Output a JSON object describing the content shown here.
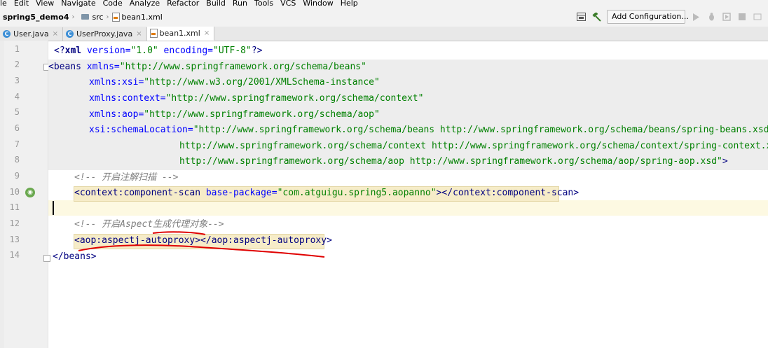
{
  "menu": [
    "le",
    "Edit",
    "View",
    "Navigate",
    "Code",
    "Analyze",
    "Refactor",
    "Build",
    "Run",
    "Tools",
    "VCS",
    "Window",
    "Help"
  ],
  "breadcrumb": {
    "project": "spring5_demo4",
    "folder": "src",
    "file": "bean1.xml"
  },
  "toolbar": {
    "config_label": "Add Configuration..."
  },
  "tabs": [
    {
      "label": "User.java",
      "icon": "class-icon",
      "active": false
    },
    {
      "label": "UserProxy.java",
      "icon": "class-icon",
      "active": false
    },
    {
      "label": "bean1.xml",
      "icon": "xml-icon",
      "active": true
    }
  ],
  "editor": {
    "line_numbers": [
      "1",
      "2",
      "3",
      "4",
      "5",
      "6",
      "7",
      "8",
      "9",
      "10",
      "11",
      "12",
      "13",
      "14"
    ],
    "lines": {
      "l1": {
        "open": "<?",
        "tag": "xml",
        "a1": " version=",
        "v1": "\"1.0\"",
        "a2": " encoding=",
        "v2": "\"UTF-8\"",
        "close": "?>"
      },
      "l2": {
        "open": "<",
        "tag": "beans",
        "attr": " xmlns=",
        "val": "\"http://www.springframework.org/schema/beans\""
      },
      "l3": {
        "attr": "xmlns:xsi=",
        "val": "\"http://www.w3.org/2001/XMLSchema-instance\""
      },
      "l4": {
        "attr": "xmlns:context=",
        "val": "\"http://www.springframework.org/schema/context\""
      },
      "l5": {
        "attr": "xmlns:aop=",
        "val": "\"http://www.springframework.org/schema/aop\""
      },
      "l6": {
        "attr": "xsi:schemaLocation=",
        "val": "\"http://www.springframework.org/schema/beans http://www.springframework.org/schema/beans/spring-beans.xsd"
      },
      "l7": {
        "val": "http://www.springframework.org/schema/context http://www.springframework.org/schema/context/spring-context.xsd"
      },
      "l8": {
        "val": "http://www.springframework.org/schema/aop http://www.springframework.org/schema/aop/spring-aop.xsd\"",
        "close": ">"
      },
      "l9": {
        "comment": "<!-- 开启注解扫描 -->"
      },
      "l10": {
        "open": "<",
        "tag": "context:component-scan",
        "attr": " base-package=",
        "val": "\"com.atguigu.spring5.aopanno\"",
        "mid": "></",
        "tag2": "context:component-scan",
        "close": ">"
      },
      "l12": {
        "comment": "<!-- 开启Aspect生成代理对象-->"
      },
      "l13": {
        "open": "<",
        "tag": "aop:aspectj-autoproxy",
        "mid": "></",
        "tag2": "aop:aspectj-autoproxy",
        "close": ">"
      },
      "l14": {
        "open": "</",
        "tag": "beans",
        "close": ">"
      }
    }
  },
  "colors": {
    "tag": "#000080",
    "attr": "#0000ff",
    "value": "#008000",
    "comment": "#808080",
    "annotation": "#e00000"
  }
}
